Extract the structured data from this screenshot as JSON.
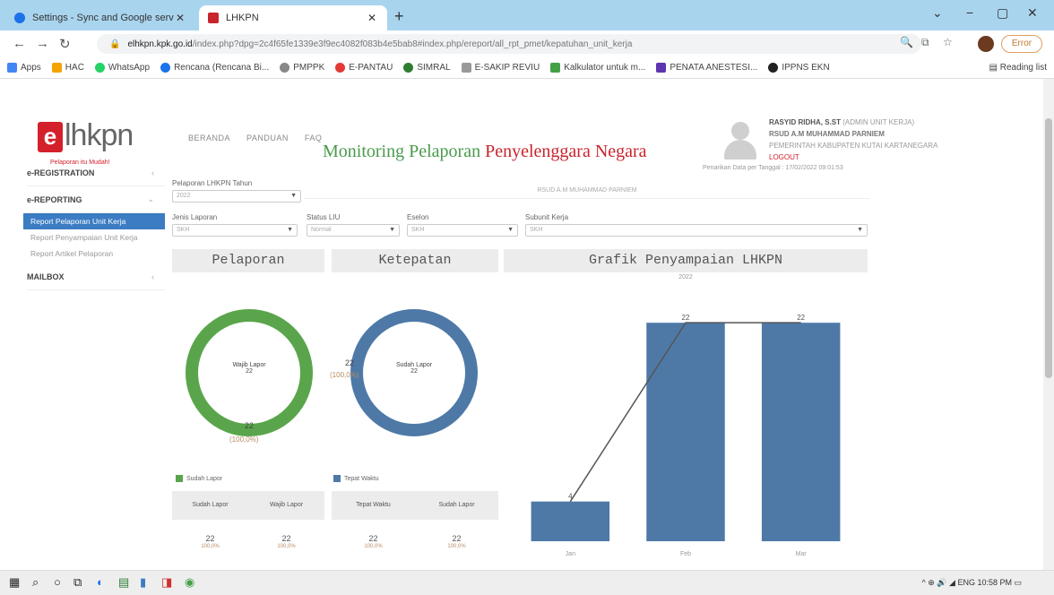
{
  "browser": {
    "tabs": [
      {
        "title": "Settings - Sync and Google serv",
        "active": false
      },
      {
        "title": "LHKPN",
        "active": true
      }
    ],
    "url_host": "elhkpn.kpk.go.id",
    "url_path": "/index.php?dpg=2c4f65fe1339e3f9ec4082f083b4e5bab8#index.php/ereport/all_rpt_pmet/kepatuhan_unit_kerja",
    "error_label": "Error",
    "bookmarks": [
      "Apps",
      "HAC",
      "WhatsApp",
      "Rencana (Rencana Bi...",
      "PMPPK",
      "E-PANTAU",
      "SIMRAL",
      "E-SAKIP REVIU",
      "Kalkulator untuk m...",
      "PENATA ANESTESI...",
      "IPPNS EKN"
    ],
    "reading_list": "Reading list"
  },
  "header": {
    "logo_mark": "e",
    "logo_rest": "lhkpn",
    "logo_tagline": "Pelaporan itu Mudah!",
    "nav": [
      "BERANDA",
      "PANDUAN",
      "FAQ"
    ],
    "user_name": "RASYID RIDHA, S.ST",
    "user_role": "(ADMIN UNIT KERJA)",
    "user_org": "RSUD A.M MUHAMMAD PARNIEM",
    "user_gov": "PEMERINTAH KABUPATEN KUTAI KARTANEGARA",
    "logout": "LOGOUT"
  },
  "sidebar": {
    "registration": "e-REGISTRATION",
    "reporting": "e-REPORTING",
    "items": [
      "Report Pelaporan Unit Kerja",
      "Report Penyampaian Unit Kerja",
      "Report Artikel Pelaporan"
    ],
    "mailbox": "MAILBOX"
  },
  "main": {
    "title_part1": "Monitoring Pelaporan ",
    "title_part2": "Penyelenggara Negara",
    "last_update": "Penarikan Data per Tanggal : 17/02/2022 09:01:53",
    "unit_name": "RSUD A.M MUHAMMAD PARNIEM",
    "filters": {
      "pelaporan_label": "Pelaporan LHKPN Tahun",
      "pelaporan_value": "2022",
      "jenis_label": "Jenis Laporan",
      "jenis_value": "SKH",
      "status_label": "Status LIU",
      "status_value": "Normal",
      "eselon_label": "Eselon",
      "eselon_value": "SKH",
      "subunit_label": "Subunit Kerja",
      "subunit_value": "SKH"
    }
  },
  "pelaporan": {
    "header": "Pelaporan",
    "center_label": "Wajib Lapor",
    "center_value": "22",
    "bottom_value": "22",
    "bottom_pct": "(100,0%)",
    "legend": "Sudah Lapor",
    "color": "#5aa54b",
    "col1": "Sudah Lapor",
    "col2": "Wajib Lapor",
    "val1": "22",
    "pct1": "100,0%",
    "val2": "22",
    "pct2": "100,0%"
  },
  "ketepatan": {
    "header": "Ketepatan",
    "center_label": "Sudah Lapor",
    "center_value": "22",
    "side_value": "22",
    "side_pct": "(100,0%)",
    "legend": "Tepat Waktu",
    "color": "#4e79a7",
    "col1": "Tepat Waktu",
    "col2": "Sudah Lapor",
    "val1": "22",
    "pct1": "100,0%",
    "val2": "22",
    "pct2": "100,0%"
  },
  "chart_data": {
    "type": "bar",
    "title": "Grafik Penyampaian LHKPN",
    "subtitle": "2022",
    "categories": [
      "Jan",
      "Feb",
      "Mar"
    ],
    "values": [
      4,
      22,
      22
    ],
    "ylim": [
      0,
      24
    ],
    "color": "#4e79a7",
    "line_overlay": true
  },
  "taskbar": {
    "time": "10:58 PM"
  }
}
